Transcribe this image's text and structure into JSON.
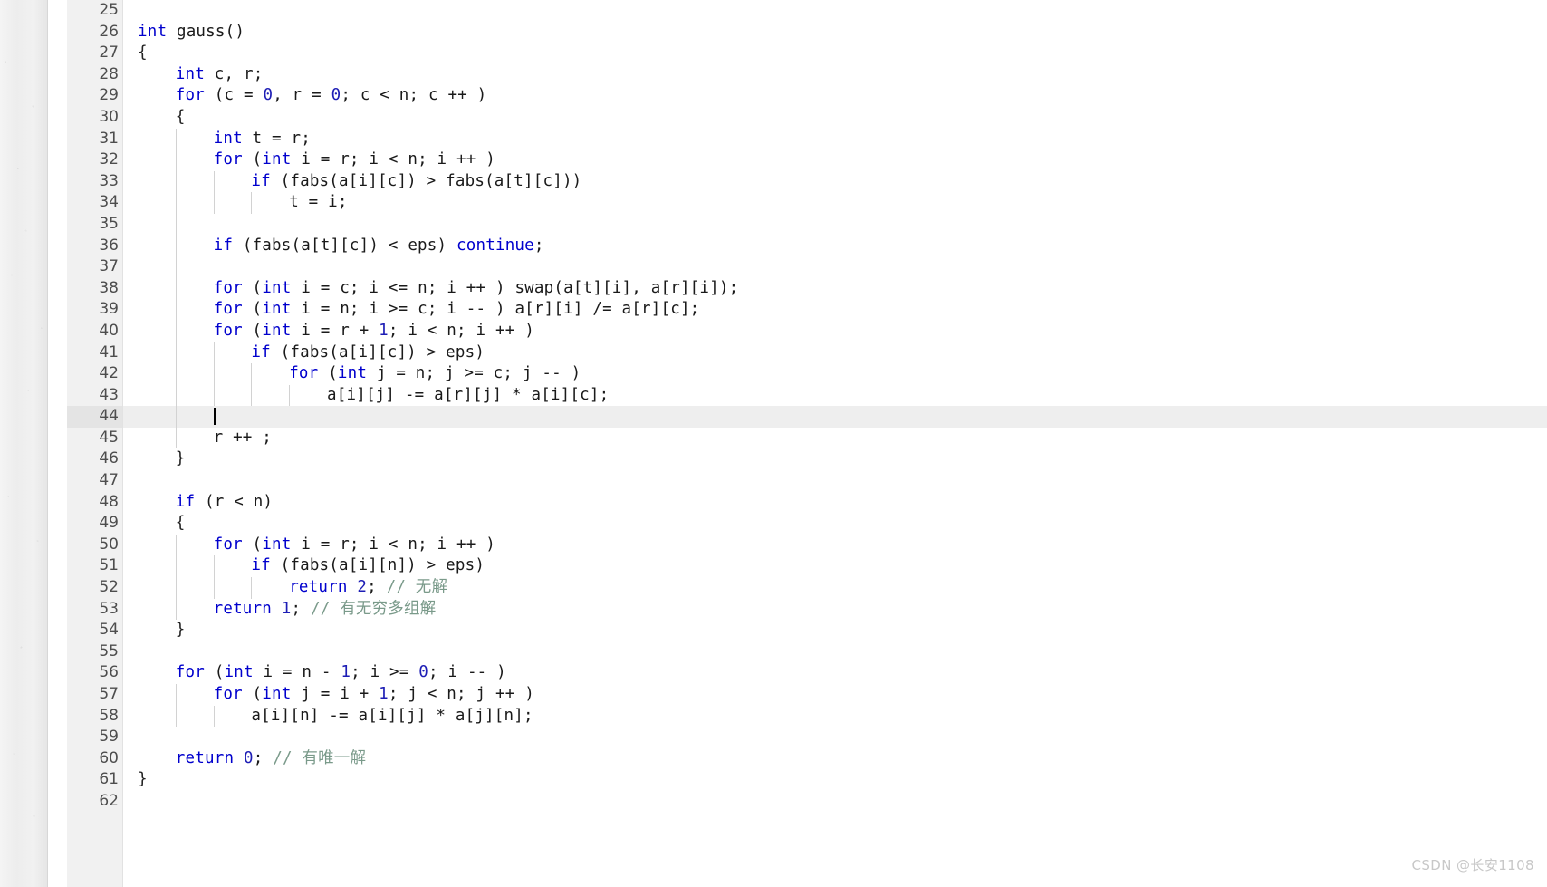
{
  "editor": {
    "language": "C++",
    "active_line": 44,
    "first_visible_line": 25,
    "colors": {
      "keyword": "#0000cd",
      "number": "#1d1db5",
      "comment": "#7a9a8a",
      "identifier": "#1a1a1a",
      "gutter_bg": "#f1f1f1",
      "active_line_bg": "#eeeeee",
      "indent_guide": "#d2d2d2",
      "editor_bg": "#ffffff"
    },
    "fold_markers": [
      27,
      30,
      49
    ],
    "lines": [
      {
        "n": "25",
        "indent": 0,
        "guides": 0,
        "tokens": []
      },
      {
        "n": "26",
        "indent": 0,
        "guides": 0,
        "tokens": [
          {
            "t": "int",
            "c": "kw"
          },
          {
            "t": " gauss()",
            "c": "ident"
          }
        ]
      },
      {
        "n": "27",
        "indent": 0,
        "guides": 0,
        "fold": true,
        "tokens": [
          {
            "t": "{",
            "c": "punct"
          }
        ]
      },
      {
        "n": "28",
        "indent": 1,
        "guides": 0,
        "tokens": [
          {
            "t": "int",
            "c": "kw"
          },
          {
            "t": " c, r;",
            "c": "ident"
          }
        ]
      },
      {
        "n": "29",
        "indent": 1,
        "guides": 0,
        "tokens": [
          {
            "t": "for",
            "c": "kw"
          },
          {
            "t": " (c = ",
            "c": "ident"
          },
          {
            "t": "0",
            "c": "num"
          },
          {
            "t": ", r = ",
            "c": "ident"
          },
          {
            "t": "0",
            "c": "num"
          },
          {
            "t": "; c < n; c ++ )",
            "c": "ident"
          }
        ]
      },
      {
        "n": "30",
        "indent": 1,
        "guides": 0,
        "fold": true,
        "tokens": [
          {
            "t": "{",
            "c": "punct"
          }
        ]
      },
      {
        "n": "31",
        "indent": 2,
        "guides": 1,
        "tokens": [
          {
            "t": "int",
            "c": "kw"
          },
          {
            "t": " t = r;",
            "c": "ident"
          }
        ]
      },
      {
        "n": "32",
        "indent": 2,
        "guides": 1,
        "tokens": [
          {
            "t": "for",
            "c": "kw"
          },
          {
            "t": " (",
            "c": "ident"
          },
          {
            "t": "int",
            "c": "kw"
          },
          {
            "t": " i = r; i < n; i ++ )",
            "c": "ident"
          }
        ]
      },
      {
        "n": "33",
        "indent": 3,
        "guides": 2,
        "tokens": [
          {
            "t": "if",
            "c": "kw"
          },
          {
            "t": " (fabs(a[i][c]) > fabs(a[t][c]))",
            "c": "ident"
          }
        ]
      },
      {
        "n": "34",
        "indent": 4,
        "guides": 3,
        "tokens": [
          {
            "t": "t = i;",
            "c": "ident"
          }
        ]
      },
      {
        "n": "35",
        "indent": 0,
        "guides": 1,
        "tokens": []
      },
      {
        "n": "36",
        "indent": 2,
        "guides": 1,
        "tokens": [
          {
            "t": "if",
            "c": "kw"
          },
          {
            "t": " (fabs(a[t][c]) < eps) ",
            "c": "ident"
          },
          {
            "t": "continue",
            "c": "kw"
          },
          {
            "t": ";",
            "c": "ident"
          }
        ]
      },
      {
        "n": "37",
        "indent": 0,
        "guides": 1,
        "tokens": []
      },
      {
        "n": "38",
        "indent": 2,
        "guides": 1,
        "tokens": [
          {
            "t": "for",
            "c": "kw"
          },
          {
            "t": " (",
            "c": "ident"
          },
          {
            "t": "int",
            "c": "kw"
          },
          {
            "t": " i = c; i <= n; i ++ ) swap(a[t][i], a[r][i]);",
            "c": "ident"
          }
        ]
      },
      {
        "n": "39",
        "indent": 2,
        "guides": 1,
        "tokens": [
          {
            "t": "for",
            "c": "kw"
          },
          {
            "t": " (",
            "c": "ident"
          },
          {
            "t": "int",
            "c": "kw"
          },
          {
            "t": " i = n; i >= c; i -- ) a[r][i] /= a[r][c];",
            "c": "ident"
          }
        ]
      },
      {
        "n": "40",
        "indent": 2,
        "guides": 1,
        "tokens": [
          {
            "t": "for",
            "c": "kw"
          },
          {
            "t": " (",
            "c": "ident"
          },
          {
            "t": "int",
            "c": "kw"
          },
          {
            "t": " i = r + ",
            "c": "ident"
          },
          {
            "t": "1",
            "c": "num"
          },
          {
            "t": "; i < n; i ++ )",
            "c": "ident"
          }
        ]
      },
      {
        "n": "41",
        "indent": 3,
        "guides": 2,
        "tokens": [
          {
            "t": "if",
            "c": "kw"
          },
          {
            "t": " (fabs(a[i][c]) > eps)",
            "c": "ident"
          }
        ]
      },
      {
        "n": "42",
        "indent": 4,
        "guides": 3,
        "tokens": [
          {
            "t": "for",
            "c": "kw"
          },
          {
            "t": " (",
            "c": "ident"
          },
          {
            "t": "int",
            "c": "kw"
          },
          {
            "t": " j = n; j >= c; j -- )",
            "c": "ident"
          }
        ]
      },
      {
        "n": "43",
        "indent": 5,
        "guides": 4,
        "tokens": [
          {
            "t": "a[i][j] -= a[r][j] * a[i][c];",
            "c": "ident"
          }
        ]
      },
      {
        "n": "44",
        "indent": 0,
        "guides": 1,
        "active": true,
        "caret_indent": 2,
        "tokens": []
      },
      {
        "n": "45",
        "indent": 2,
        "guides": 1,
        "tokens": [
          {
            "t": "r ++ ;",
            "c": "ident"
          }
        ]
      },
      {
        "n": "46",
        "indent": 1,
        "guides": 0,
        "tokens": [
          {
            "t": "}",
            "c": "punct"
          }
        ]
      },
      {
        "n": "47",
        "indent": 0,
        "guides": 0,
        "tokens": []
      },
      {
        "n": "48",
        "indent": 1,
        "guides": 0,
        "tokens": [
          {
            "t": "if",
            "c": "kw"
          },
          {
            "t": " (r < n)",
            "c": "ident"
          }
        ]
      },
      {
        "n": "49",
        "indent": 1,
        "guides": 0,
        "fold": true,
        "tokens": [
          {
            "t": "{",
            "c": "punct"
          }
        ]
      },
      {
        "n": "50",
        "indent": 2,
        "guides": 1,
        "tokens": [
          {
            "t": "for",
            "c": "kw"
          },
          {
            "t": " (",
            "c": "ident"
          },
          {
            "t": "int",
            "c": "kw"
          },
          {
            "t": " i = r; i < n; i ++ )",
            "c": "ident"
          }
        ]
      },
      {
        "n": "51",
        "indent": 3,
        "guides": 2,
        "tokens": [
          {
            "t": "if",
            "c": "kw"
          },
          {
            "t": " (fabs(a[i][n]) > eps)",
            "c": "ident"
          }
        ]
      },
      {
        "n": "52",
        "indent": 4,
        "guides": 3,
        "tokens": [
          {
            "t": "return",
            "c": "kw"
          },
          {
            "t": " ",
            "c": "ident"
          },
          {
            "t": "2",
            "c": "num"
          },
          {
            "t": "; ",
            "c": "ident"
          },
          {
            "t": "// 无解",
            "c": "comment"
          }
        ]
      },
      {
        "n": "53",
        "indent": 2,
        "guides": 1,
        "tokens": [
          {
            "t": "return",
            "c": "kw"
          },
          {
            "t": " ",
            "c": "ident"
          },
          {
            "t": "1",
            "c": "num"
          },
          {
            "t": "; ",
            "c": "ident"
          },
          {
            "t": "// 有无穷多组解",
            "c": "comment"
          }
        ]
      },
      {
        "n": "54",
        "indent": 1,
        "guides": 0,
        "tokens": [
          {
            "t": "}",
            "c": "punct"
          }
        ]
      },
      {
        "n": "55",
        "indent": 0,
        "guides": 0,
        "tokens": []
      },
      {
        "n": "56",
        "indent": 1,
        "guides": 0,
        "tokens": [
          {
            "t": "for",
            "c": "kw"
          },
          {
            "t": " (",
            "c": "ident"
          },
          {
            "t": "int",
            "c": "kw"
          },
          {
            "t": " i = n - ",
            "c": "ident"
          },
          {
            "t": "1",
            "c": "num"
          },
          {
            "t": "; i >= ",
            "c": "ident"
          },
          {
            "t": "0",
            "c": "num"
          },
          {
            "t": "; i -- )",
            "c": "ident"
          }
        ]
      },
      {
        "n": "57",
        "indent": 2,
        "guides": 1,
        "tokens": [
          {
            "t": "for",
            "c": "kw"
          },
          {
            "t": " (",
            "c": "ident"
          },
          {
            "t": "int",
            "c": "kw"
          },
          {
            "t": " j = i + ",
            "c": "ident"
          },
          {
            "t": "1",
            "c": "num"
          },
          {
            "t": "; j < n; j ++ )",
            "c": "ident"
          }
        ]
      },
      {
        "n": "58",
        "indent": 3,
        "guides": 2,
        "tokens": [
          {
            "t": "a[i][n] -= a[i][j] * a[j][n];",
            "c": "ident"
          }
        ]
      },
      {
        "n": "59",
        "indent": 0,
        "guides": 0,
        "tokens": []
      },
      {
        "n": "60",
        "indent": 1,
        "guides": 0,
        "tokens": [
          {
            "t": "return",
            "c": "kw"
          },
          {
            "t": " ",
            "c": "ident"
          },
          {
            "t": "0",
            "c": "num"
          },
          {
            "t": "; ",
            "c": "ident"
          },
          {
            "t": "// 有唯一解",
            "c": "comment"
          }
        ]
      },
      {
        "n": "61",
        "indent": 0,
        "guides": 0,
        "tokens": [
          {
            "t": "}",
            "c": "punct"
          }
        ]
      },
      {
        "n": "62",
        "indent": 0,
        "guides": 0,
        "tokens": []
      }
    ]
  },
  "watermark": {
    "text": "CSDN @长安1108"
  }
}
